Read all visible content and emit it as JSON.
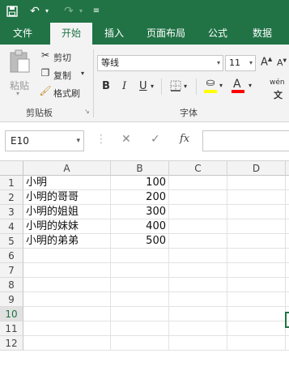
{
  "quick_access": {
    "save_icon": "save-icon",
    "undo_icon": "undo-icon",
    "redo_icon": "redo-icon",
    "customize_icon": "customize-icon"
  },
  "tabs": [
    {
      "label": "文件",
      "active": false
    },
    {
      "label": "开始",
      "active": true
    },
    {
      "label": "插入",
      "active": false
    },
    {
      "label": "页面布局",
      "active": false
    },
    {
      "label": "公式",
      "active": false
    },
    {
      "label": "数据",
      "active": false
    }
  ],
  "ribbon": {
    "clipboard": {
      "paste": "粘贴",
      "cut": "剪切",
      "copy": "复制",
      "format_painter": "格式刷",
      "group_label": "剪贴板"
    },
    "font": {
      "font_name": "等线",
      "font_size": "11",
      "bold": "B",
      "italic": "I",
      "underline": "U",
      "grow": "A",
      "shrink": "A",
      "group_label": "字体",
      "phonetic": "wén"
    }
  },
  "formula_bar": {
    "name_box": "E10",
    "cancel": "✕",
    "enter": "✓",
    "fx": "fx",
    "value": ""
  },
  "columns": [
    "A",
    "B",
    "C",
    "D"
  ],
  "rows": [
    {
      "num": "1",
      "a": "小明",
      "b": "100"
    },
    {
      "num": "2",
      "a": "小明的哥哥",
      "b": "200"
    },
    {
      "num": "3",
      "a": "小明的姐姐",
      "b": "300"
    },
    {
      "num": "4",
      "a": "小明的妹妹",
      "b": "400"
    },
    {
      "num": "5",
      "a": "小明的弟弟",
      "b": "500"
    },
    {
      "num": "6",
      "a": "",
      "b": ""
    },
    {
      "num": "7",
      "a": "",
      "b": ""
    },
    {
      "num": "8",
      "a": "",
      "b": ""
    },
    {
      "num": "9",
      "a": "",
      "b": ""
    },
    {
      "num": "10",
      "a": "",
      "b": ""
    },
    {
      "num": "11",
      "a": "",
      "b": ""
    },
    {
      "num": "12",
      "a": "",
      "b": ""
    }
  ],
  "selected_row": "10",
  "colors": {
    "brand": "#217346",
    "ribbon_bg": "#f3f3f3"
  }
}
